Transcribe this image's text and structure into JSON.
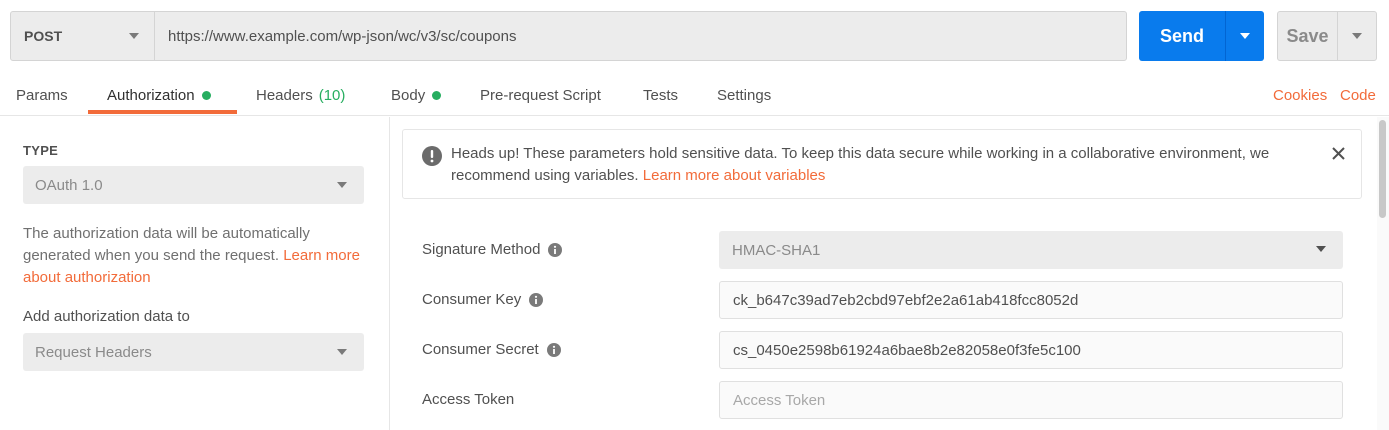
{
  "request": {
    "method": "POST",
    "url": "https://www.example.com/wp-json/wc/v3/sc/coupons",
    "send_label": "Send",
    "save_label": "Save"
  },
  "tabs": [
    {
      "label": "Params"
    },
    {
      "label": "Authorization",
      "active": true,
      "indicator": "green-dot"
    },
    {
      "label": "Headers",
      "count": "(10)"
    },
    {
      "label": "Body",
      "indicator": "green-dot"
    },
    {
      "label": "Pre-request Script"
    },
    {
      "label": "Tests"
    },
    {
      "label": "Settings"
    }
  ],
  "tab_links": {
    "cookies": "Cookies",
    "code": "Code"
  },
  "auth": {
    "type_heading": "TYPE",
    "type_value": "OAuth 1.0",
    "help_text": "The authorization data will be automatically generated when you send the request.",
    "help_link": "Learn more about authorization",
    "add_to_label": "Add authorization data to",
    "add_to_value": "Request Headers"
  },
  "alert": {
    "text": "Heads up! These parameters hold sensitive data. To keep this data secure while working in a collaborative environment, we recommend using variables.",
    "link": "Learn more about variables"
  },
  "fields": {
    "signature_method": {
      "label": "Signature Method",
      "value": "HMAC-SHA1"
    },
    "consumer_key": {
      "label": "Consumer Key",
      "value": "ck_b647c39ad7eb2cbd97ebf2e2a61ab418fcc8052d"
    },
    "consumer_secret": {
      "label": "Consumer Secret",
      "value": "cs_0450e2598b61924a6bae8b2e82058e0f3fe5c100"
    },
    "access_token": {
      "label": "Access Token",
      "placeholder": "Access Token"
    }
  },
  "colors": {
    "accent": "#f26b3a",
    "primary": "#097bed",
    "success": "#27ae60"
  }
}
